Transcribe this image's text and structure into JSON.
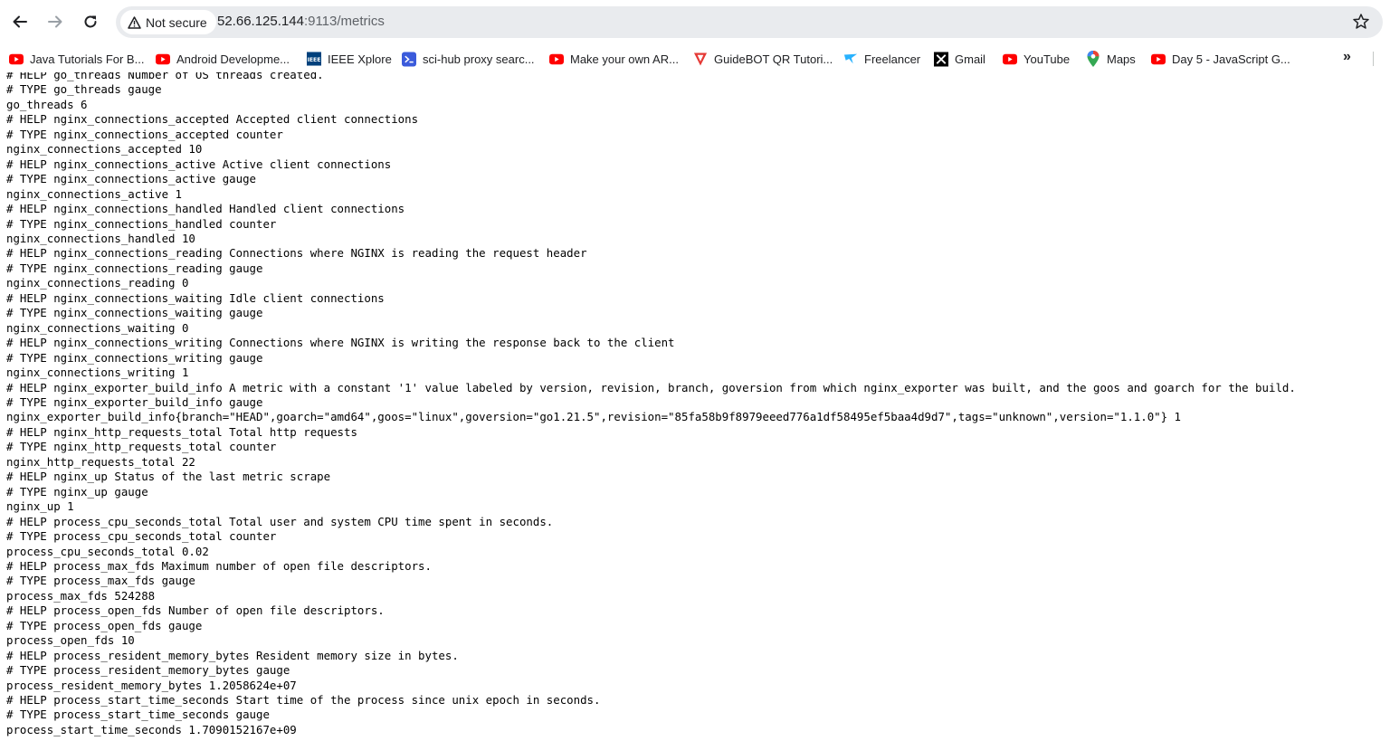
{
  "browser": {
    "security_label": "Not secure",
    "url_host": "52.66.125.144",
    "url_rest": ":9113/metrics",
    "bookmarks": [
      {
        "label": "Java Tutorials For B...",
        "icon": "youtube-icon"
      },
      {
        "label": "Android Developme...",
        "icon": "youtube-icon"
      },
      {
        "label": "IEEE Xplore",
        "icon": "ieee-icon"
      },
      {
        "label": "sci-hub proxy searc...",
        "icon": "terminal-icon"
      },
      {
        "label": "Make your own AR...",
        "icon": "youtube-icon"
      },
      {
        "label": "GuideBOT QR Tutori...",
        "icon": "guidebot-icon"
      },
      {
        "label": "Freelancer",
        "icon": "freelancer-icon"
      },
      {
        "label": "Gmail",
        "icon": "x-icon"
      },
      {
        "label": "YouTube",
        "icon": "youtube-icon"
      },
      {
        "label": "Maps",
        "icon": "maps-pin-icon"
      },
      {
        "label": "Day 5 - JavaScript G...",
        "icon": "youtube-icon"
      }
    ],
    "colors": {
      "youtube_red": "#ff0000",
      "omnibox_bg": "#e9ebee",
      "text": "#202124"
    }
  },
  "metrics_lines": [
    "# HELP go_threads Number of OS threads created.",
    "# TYPE go_threads gauge",
    "go_threads 6",
    "# HELP nginx_connections_accepted Accepted client connections",
    "# TYPE nginx_connections_accepted counter",
    "nginx_connections_accepted 10",
    "# HELP nginx_connections_active Active client connections",
    "# TYPE nginx_connections_active gauge",
    "nginx_connections_active 1",
    "# HELP nginx_connections_handled Handled client connections",
    "# TYPE nginx_connections_handled counter",
    "nginx_connections_handled 10",
    "# HELP nginx_connections_reading Connections where NGINX is reading the request header",
    "# TYPE nginx_connections_reading gauge",
    "nginx_connections_reading 0",
    "# HELP nginx_connections_waiting Idle client connections",
    "# TYPE nginx_connections_waiting gauge",
    "nginx_connections_waiting 0",
    "# HELP nginx_connections_writing Connections where NGINX is writing the response back to the client",
    "# TYPE nginx_connections_writing gauge",
    "nginx_connections_writing 1",
    "# HELP nginx_exporter_build_info A metric with a constant '1' value labeled by version, revision, branch, goversion from which nginx_exporter was built, and the goos and goarch for the build.",
    "# TYPE nginx_exporter_build_info gauge",
    "nginx_exporter_build_info{branch=\"HEAD\",goarch=\"amd64\",goos=\"linux\",goversion=\"go1.21.5\",revision=\"85fa58b9f8979eeed776a1df58495ef5baa4d9d7\",tags=\"unknown\",version=\"1.1.0\"} 1",
    "# HELP nginx_http_requests_total Total http requests",
    "# TYPE nginx_http_requests_total counter",
    "nginx_http_requests_total 22",
    "# HELP nginx_up Status of the last metric scrape",
    "# TYPE nginx_up gauge",
    "nginx_up 1",
    "# HELP process_cpu_seconds_total Total user and system CPU time spent in seconds.",
    "# TYPE process_cpu_seconds_total counter",
    "process_cpu_seconds_total 0.02",
    "# HELP process_max_fds Maximum number of open file descriptors.",
    "# TYPE process_max_fds gauge",
    "process_max_fds 524288",
    "# HELP process_open_fds Number of open file descriptors.",
    "# TYPE process_open_fds gauge",
    "process_open_fds 10",
    "# HELP process_resident_memory_bytes Resident memory size in bytes.",
    "# TYPE process_resident_memory_bytes gauge",
    "process_resident_memory_bytes 1.2058624e+07",
    "# HELP process_start_time_seconds Start time of the process since unix epoch in seconds.",
    "# TYPE process_start_time_seconds gauge",
    "process_start_time_seconds 1.7090152167e+09"
  ]
}
